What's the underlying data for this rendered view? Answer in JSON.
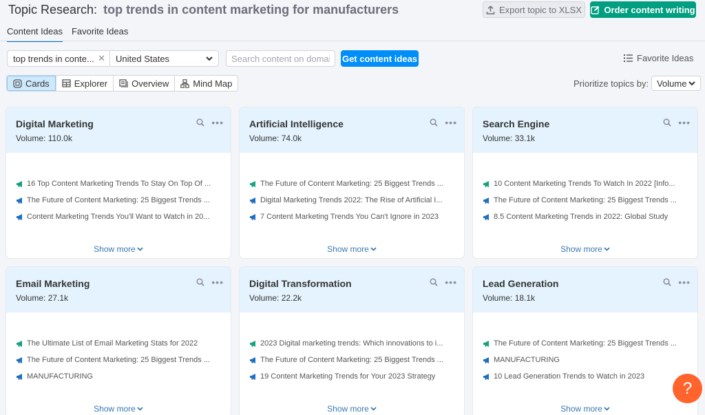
{
  "header": {
    "title_prefix": "Topic Research:",
    "title_query": "top trends in content marketing for manufacturers",
    "export_label": "Export topic to XLSX",
    "order_label": "Order content writing"
  },
  "tabs": [
    {
      "label": "Content Ideas",
      "active": true
    },
    {
      "label": "Favorite Ideas",
      "active": false
    }
  ],
  "filters": {
    "keyword_value": "top trends in conte...",
    "country_value": "United States",
    "domain_placeholder": "Search content on domain",
    "get_ideas_label": "Get content ideas",
    "favorite_ideas_label": "Favorite Ideas"
  },
  "views": [
    {
      "label": "Cards",
      "icon": "cards-icon",
      "active": true
    },
    {
      "label": "Explorer",
      "icon": "table-icon",
      "active": false
    },
    {
      "label": "Overview",
      "icon": "overview-icon",
      "active": false
    },
    {
      "label": "Mind Map",
      "icon": "mind-map-icon",
      "active": false
    }
  ],
  "prioritize": {
    "label": "Prioritize topics by:",
    "value": "Volume"
  },
  "colors": {
    "top_headline_icon": "#13a37a",
    "headline_icon": "#1d6fc2",
    "accent_blue": "#008ff8",
    "accent_green": "#009f81",
    "help_orange": "#ff642d"
  },
  "cards": [
    {
      "title": "Digital Marketing",
      "volume": "Volume: 110.0k",
      "headlines": [
        "16 Top Content Marketing Trends To Stay On Top Of ...",
        "The Future of Content Marketing: 25 Biggest Trends ...",
        "Content Marketing Trends You'll Want to Watch in 20..."
      ],
      "show_more": "Show more"
    },
    {
      "title": "Artificial Intelligence",
      "volume": "Volume: 74.0k",
      "headlines": [
        "The Future of Content Marketing: 25 Biggest Trends ...",
        "Digital Marketing Trends 2022: The Rise of Artificial I...",
        "7 Content Marketing Trends You Can't Ignore in 2023"
      ],
      "show_more": "Show more"
    },
    {
      "title": "Search Engine",
      "volume": "Volume: 33.1k",
      "headlines": [
        "10 Content Marketing Trends To Watch In 2022 [Info...",
        "The Future of Content Marketing: 25 Biggest Trends ...",
        "8.5 Content Marketing Trends in 2022: Global Study"
      ],
      "show_more": "Show more"
    },
    {
      "title": "Email Marketing",
      "volume": "Volume: 27.1k",
      "headlines": [
        "The Ultimate List of Email Marketing Stats for 2022",
        "The Future of Content Marketing: 25 Biggest Trends ...",
        "MANUFACTURING"
      ],
      "show_more": "Show more"
    },
    {
      "title": "Digital Transformation",
      "volume": "Volume: 22.2k",
      "headlines": [
        "2023 Digital marketing trends: Which innovations to i...",
        "The Future of Content Marketing: 25 Biggest Trends ...",
        "19 Content Marketing Trends for Your 2023 Strategy"
      ],
      "show_more": "Show more"
    },
    {
      "title": "Lead Generation",
      "volume": "Volume: 18.1k",
      "headlines": [
        "The Future of Content Marketing: 25 Biggest Trends ...",
        "MANUFACTURING",
        "10 Lead Generation Trends to Watch in 2023"
      ],
      "show_more": "Show more"
    }
  ],
  "help_label": "?"
}
